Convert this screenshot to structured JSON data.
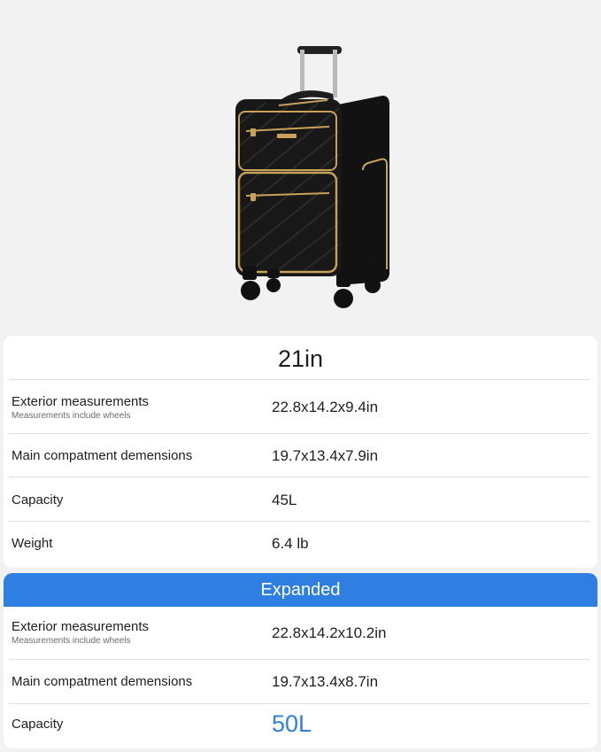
{
  "product_image": {
    "icon": "suitcase-image",
    "colors": {
      "body": "#151515",
      "zipper": "#c8a15a",
      "handle": "#b9b9b9",
      "wheel": "#111111"
    }
  },
  "standard": {
    "size_label": "21in",
    "rows": [
      {
        "label": "Exterior measurements",
        "sublabel": "Measurements include wheels",
        "value": "22.8x14.2x9.4in"
      },
      {
        "label": "Main compatment demensions",
        "value": "19.7x13.4x7.9in"
      },
      {
        "label": "Capacity",
        "value": "45L"
      },
      {
        "label": "Weight",
        "value": "6.4 lb"
      }
    ]
  },
  "expanded": {
    "header": "Expanded",
    "header_color": "#2f7fe2",
    "rows": [
      {
        "label": "Exterior measurements",
        "sublabel": "Measurements include wheels",
        "value": "22.8x14.2x10.2in"
      },
      {
        "label": "Main compatment demensions",
        "value": "19.7x13.4x8.7in"
      },
      {
        "label": "Capacity",
        "value": "50L",
        "value_color": "#2f7fe2"
      }
    ]
  }
}
